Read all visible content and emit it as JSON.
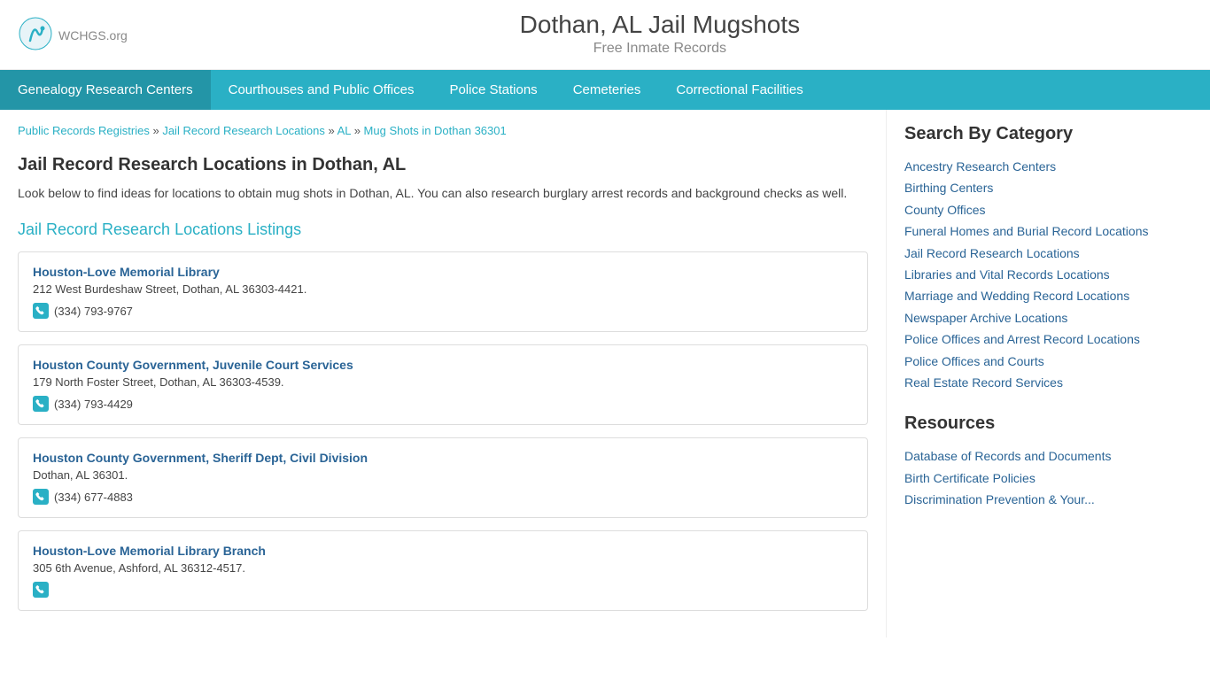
{
  "header": {
    "logo_text": "WCHGS",
    "logo_suffix": ".org",
    "site_title": "Dothan, AL Jail Mugshots",
    "site_subtitle": "Free Inmate Records"
  },
  "nav": {
    "items": [
      {
        "label": "Genealogy Research Centers",
        "active": true
      },
      {
        "label": "Courthouses and Public Offices",
        "active": false
      },
      {
        "label": "Police Stations",
        "active": false
      },
      {
        "label": "Cemeteries",
        "active": false
      },
      {
        "label": "Correctional Facilities",
        "active": false
      }
    ]
  },
  "breadcrumb": {
    "items": [
      {
        "label": "Public Records Registries",
        "href": "#"
      },
      {
        "label": "Jail Record Research Locations",
        "href": "#"
      },
      {
        "label": "AL",
        "href": "#"
      },
      {
        "label": "Mug Shots in Dothan 36301",
        "href": "#"
      }
    ],
    "separator": "»"
  },
  "main": {
    "page_title": "Jail Record Research Locations in Dothan, AL",
    "page_desc": "Look below to find ideas for locations to obtain mug shots in Dothan, AL. You can also research burglary arrest records and background checks as well.",
    "listings_title": "Jail Record Research Locations Listings",
    "listings": [
      {
        "name": "Houston-Love Memorial Library",
        "address": "212 West Burdeshaw Street, Dothan, AL 36303-4421.",
        "phone": "(334) 793-9767"
      },
      {
        "name": "Houston County Government, Juvenile Court Services",
        "address": "179 North Foster Street, Dothan, AL 36303-4539.",
        "phone": "(334) 793-4429"
      },
      {
        "name": "Houston County Government, Sheriff Dept, Civil Division",
        "address": "Dothan, AL 36301.",
        "phone": "(334) 677-4883"
      },
      {
        "name": "Houston-Love Memorial Library Branch",
        "address": "305 6th Avenue, Ashford, AL 36312-4517.",
        "phone": ""
      }
    ]
  },
  "sidebar": {
    "category_heading": "Search By Category",
    "categories": [
      "Ancestry Research Centers",
      "Birthing Centers",
      "County Offices",
      "Funeral Homes and Burial Record Locations",
      "Jail Record Research Locations",
      "Libraries and Vital Records Locations",
      "Marriage and Wedding Record Locations",
      "Newspaper Archive Locations",
      "Police Offices and Arrest Record Locations",
      "Police Offices and Courts",
      "Real Estate Record Services"
    ],
    "resources_heading": "Resources",
    "resources": [
      "Database of Records and Documents",
      "Birth Certificate Policies",
      "Discrimination Prevention & Your..."
    ]
  }
}
